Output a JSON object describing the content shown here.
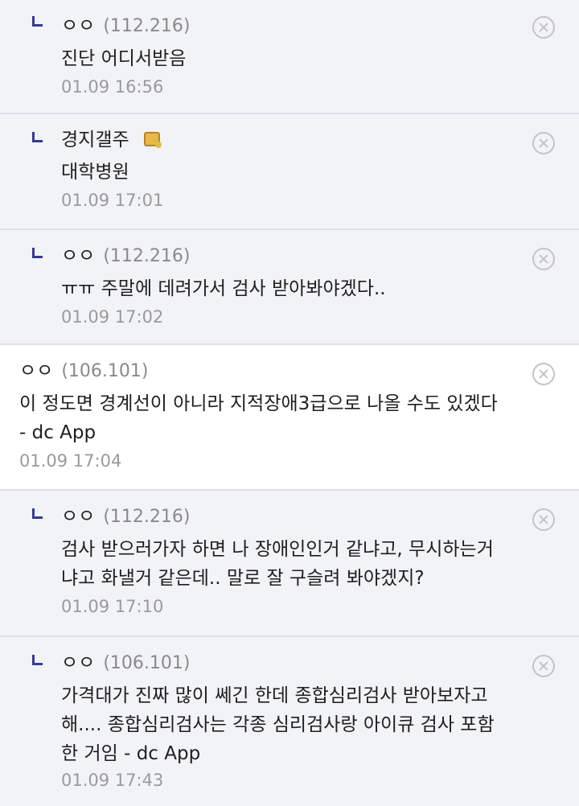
{
  "comments": [
    {
      "type": "reply",
      "nick": "ㅇㅇ",
      "ip": "(112.216)",
      "text": "진단 어디서받음",
      "date": "01.09 16:56",
      "badge": false
    },
    {
      "type": "reply",
      "nick": "경지갤주",
      "ip": "",
      "text": "대학병원",
      "date": "01.09 17:01",
      "badge": true
    },
    {
      "type": "reply",
      "nick": "ㅇㅇ",
      "ip": "(112.216)",
      "text": "ㅠㅠ 주말에 데려가서 검사 받아봐야겠다..",
      "date": "01.09 17:02",
      "badge": false
    },
    {
      "type": "top",
      "nick": "ㅇㅇ",
      "ip": "(106.101)",
      "text": "이 정도면 경계선이 아니라 지적장애3급으로 나올 수도 있겠다\n- dc App",
      "date": "01.09 17:04",
      "badge": false
    },
    {
      "type": "reply",
      "nick": "ㅇㅇ",
      "ip": "(112.216)",
      "text": "검사 받으러가자 하면 나 장애인인거 같냐고, 무시하는거\n냐고 화낼거 같은데.. 말로 잘 구슬려 봐야겠지?",
      "date": "01.09 17:10",
      "badge": false
    },
    {
      "type": "reply",
      "nick": "ㅇㅇ",
      "ip": "(106.101)",
      "text": "가격대가 진짜 많이 쎄긴 한데 종합심리검사 받아보자고\n해.... 종합심리검사는 각종 심리검사랑 아이큐 검사 포함\n한 거임 - dc App",
      "date": "01.09 17:43",
      "badge": false
    }
  ],
  "icons": {
    "reply": "reply-arrow-icon",
    "delete": "delete-circle-x-icon",
    "badge": "gallery-manager-badge-icon"
  },
  "colors": {
    "reply_background": "#f2f3f7",
    "top_background": "#ffffff",
    "reply_mark": "#33399a",
    "muted_text": "#9a9a9a"
  }
}
